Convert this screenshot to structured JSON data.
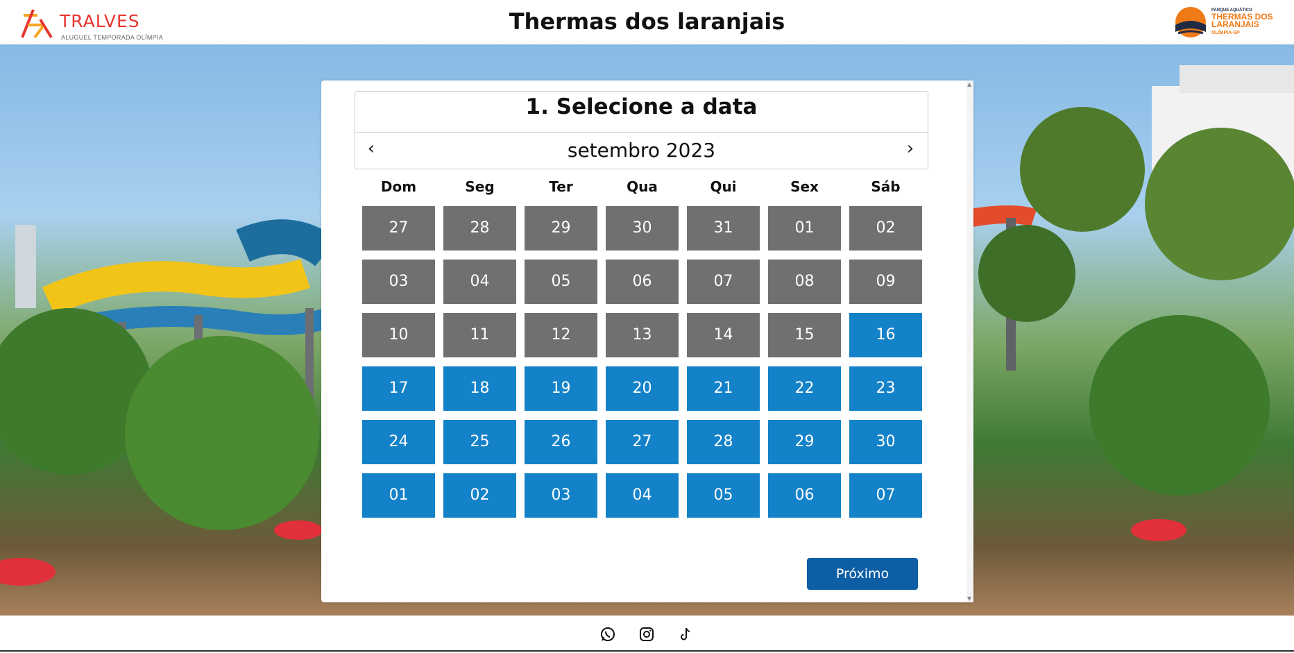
{
  "header": {
    "brand_name": "TRALVES",
    "brand_tagline": "ALUGUEL TEMPORADA OLÍMPIA",
    "title": "Thermas dos laranjais",
    "partner_small": "PARQUE AQUÁTICO",
    "partner_name": "THERMAS DOS LARANJAIS",
    "partner_city": "OLÍMPIA-SP"
  },
  "calendar": {
    "heading": "1. Selecione a data",
    "month": "setembro 2023",
    "prev_icon": "chevron-left-icon",
    "next_icon": "chevron-right-icon",
    "weekdays": [
      "Dom",
      "Seg",
      "Ter",
      "Qua",
      "Qui",
      "Sex",
      "Sáb"
    ],
    "weeks": [
      [
        "27",
        "28",
        "29",
        "30",
        "31",
        "01",
        "02"
      ],
      [
        "03",
        "04",
        "05",
        "06",
        "07",
        "08",
        "09"
      ],
      [
        "10",
        "11",
        "12",
        "13",
        "14",
        "15",
        "16"
      ],
      [
        "17",
        "18",
        "19",
        "20",
        "21",
        "22",
        "23"
      ],
      [
        "24",
        "25",
        "26",
        "27",
        "28",
        "29",
        "30"
      ],
      [
        "01",
        "02",
        "03",
        "04",
        "05",
        "06",
        "07"
      ]
    ],
    "available_from_day": "16",
    "colors": {
      "unavailable": "#707070",
      "available": "#1482c8"
    }
  },
  "actions": {
    "next_label": "Próximo",
    "next_color": "#0d5ea5"
  },
  "footer": {
    "icons": [
      "whatsapp-icon",
      "instagram-icon",
      "tiktok-icon"
    ]
  }
}
